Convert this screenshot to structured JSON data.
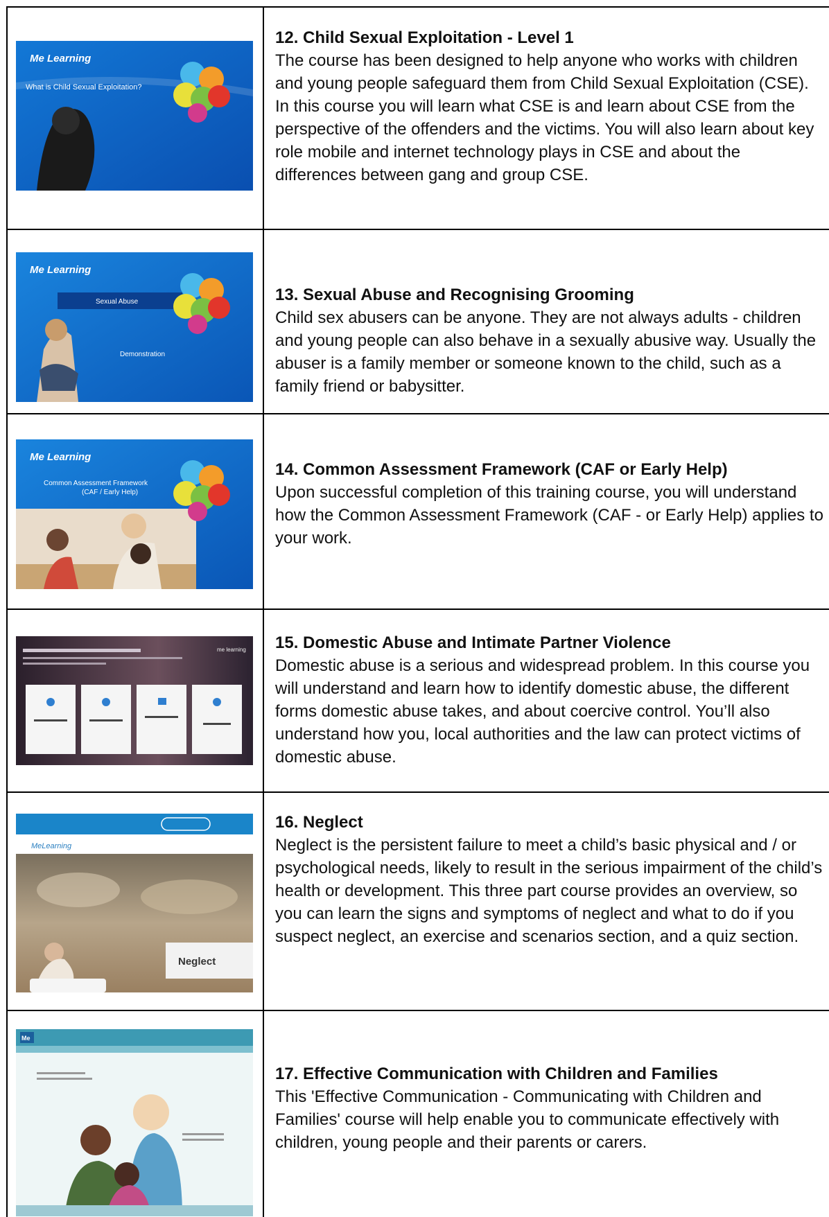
{
  "courses": [
    {
      "title": "12. Child Sexual Exploitation - Level 1",
      "description": "The course has been designed to help anyone who works with children and young people safeguard them from Child Sexual Exploitation (CSE). In this course you will learn what CSE is and learn about CSE from the perspective of the offenders and the victims. You will also learn about key role mobile and internet technology plays in CSE and about the differences between gang and group CSE.",
      "thumb": {
        "logo": "Me Learning",
        "caption": "What is Child Sexual Exploitation?"
      }
    },
    {
      "title": "13. Sexual Abuse and Recognising Grooming",
      "description": "Child sex abusers can be anyone. They are not always adults - children and young people can also behave in a sexually abusive way. Usually the abuser is a family member or someone known to the child, such as a family friend or babysitter.",
      "thumb": {
        "logo": "Me Learning",
        "caption": "Sexual Abuse",
        "caption2": "Demonstration"
      }
    },
    {
      "title": "14. Common Assessment Framework (CAF or Early Help)",
      "description": "Upon successful completion of this training course, you will understand how the Common Assessment Framework (CAF - or Early Help) applies to your work.",
      "thumb": {
        "logo": "Me Learning",
        "caption": "Common Assessment Framework",
        "caption2": "(CAF / Early Help)"
      }
    },
    {
      "title": "15. Domestic Abuse and Intimate Partner Violence",
      "description": "Domestic abuse is a serious and widespread problem. In this course you will understand and learn how to identify domestic abuse, the different forms domestic abuse takes, and about coercive control. You’ll also understand how you, local authorities and the law can protect victims of domestic abuse.",
      "thumb": {
        "logo": "me learning"
      }
    },
    {
      "title": "16. Neglect",
      "description": "Neglect is the persistent failure to meet a child’s basic physical and / or psychological needs, likely to result in the serious impairment of the child’s health or development. This three part course provides an overview, so you can learn the signs and symptoms of neglect and what to do if you suspect neglect, an exercise and scenarios section, and a quiz section.",
      "thumb": {
        "logo": "MeLearning",
        "caption": "Neglect"
      }
    },
    {
      "title": "17. Effective Communication with Children and Families",
      "description": "This 'Effective Communication - Communicating with Children and Families' course will help enable you to communicate effectively with children, young people and their parents or carers.",
      "thumb": {
        "logo": "Me"
      }
    }
  ],
  "colors": {
    "thumb_blue": "#0a63c7",
    "thumb_blue_dark": "#0847a3",
    "border": "#000000"
  }
}
